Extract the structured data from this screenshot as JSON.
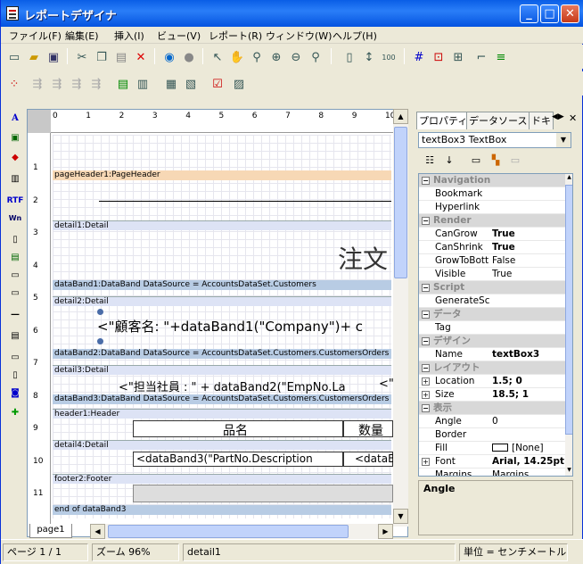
{
  "window": {
    "title": "レポートデザイナ",
    "min": "_",
    "max": "□",
    "close": "✕"
  },
  "menu": [
    "ファイル(F)",
    "編集(E)",
    "挿入(I)",
    "ビュー(V)",
    "レポート(R)",
    "ウィンドウ(W)",
    "ヘルプ(H)"
  ],
  "ruler": {
    "h": [
      "0",
      "1",
      "2",
      "3",
      "4",
      "5",
      "6",
      "7",
      "8",
      "9",
      "10"
    ],
    "v": [
      "1",
      "2",
      "3",
      "4",
      "5",
      "6",
      "7",
      "8",
      "9",
      "10",
      "11"
    ]
  },
  "bands": [
    "pageHeader1:PageHeader",
    "detail1:Detail",
    "dataBand1:DataBand DataSource = AccountsDataSet.Customers",
    "detail2:Detail",
    "dataBand2:DataBand DataSource = AccountsDataSet.Customers.CustomersOrders",
    "detail3:Detail",
    "dataBand3:DataBand DataSource = AccountsDataSet.Customers.CustomersOrders",
    "header1:Header",
    "detail4:Detail",
    "footer2:Footer",
    "end of dataBand3"
  ],
  "content": {
    "big": "注文",
    "customer": "<\"顧客名: \"+dataBand1(\"Company\")+  c",
    "staff": "<\"担当社員 : \" + dataBand2(\"EmpNo.La",
    "staff2": "<\"",
    "col1": "品名",
    "col2": "数量",
    "cell1": "<dataBand3(\"PartNo.Description",
    "cell2": "<dataB"
  },
  "page_tab": "page1",
  "panel": {
    "tabs": [
      "プロパティ",
      "データソース",
      "ドキ"
    ],
    "object": "textBox3 TextBox",
    "desc": "Angle",
    "rows": [
      {
        "cat": true,
        "name": "Navigation"
      },
      {
        "name": "Bookmark",
        "value": ""
      },
      {
        "name": "Hyperlink",
        "value": ""
      },
      {
        "cat": true,
        "name": "Render"
      },
      {
        "name": "CanGrow",
        "value": "True",
        "bold": true
      },
      {
        "name": "CanShrink",
        "value": "True",
        "bold": true
      },
      {
        "name": "GrowToBott",
        "value": "False"
      },
      {
        "name": "Visible",
        "value": "True"
      },
      {
        "cat": true,
        "name": "Script"
      },
      {
        "name": "GenerateScr",
        "value": ""
      },
      {
        "cat": true,
        "name": "データ"
      },
      {
        "name": "Tag",
        "value": ""
      },
      {
        "cat": true,
        "name": "デザイン"
      },
      {
        "name": "Name",
        "value": "textBox3",
        "bold": true
      },
      {
        "cat": true,
        "name": "レイアウト"
      },
      {
        "name": "Location",
        "value": "1.5; 0",
        "bold": true,
        "exp": true
      },
      {
        "name": "Size",
        "value": "18.5; 1",
        "bold": true,
        "exp": true
      },
      {
        "cat": true,
        "name": "表示"
      },
      {
        "name": "Angle",
        "value": "0"
      },
      {
        "name": "Border",
        "value": ""
      },
      {
        "name": "Fill",
        "value": "[None]"
      },
      {
        "name": "Font",
        "value": "Arial, 14.25pt",
        "bold": true,
        "exp": true
      },
      {
        "name": "Margins",
        "value": "Margins"
      }
    ]
  },
  "status": {
    "page": "ページ 1 / 1",
    "zoom": "ズーム 96%",
    "object": "detail1",
    "unit": "単位 = センチメートル"
  }
}
